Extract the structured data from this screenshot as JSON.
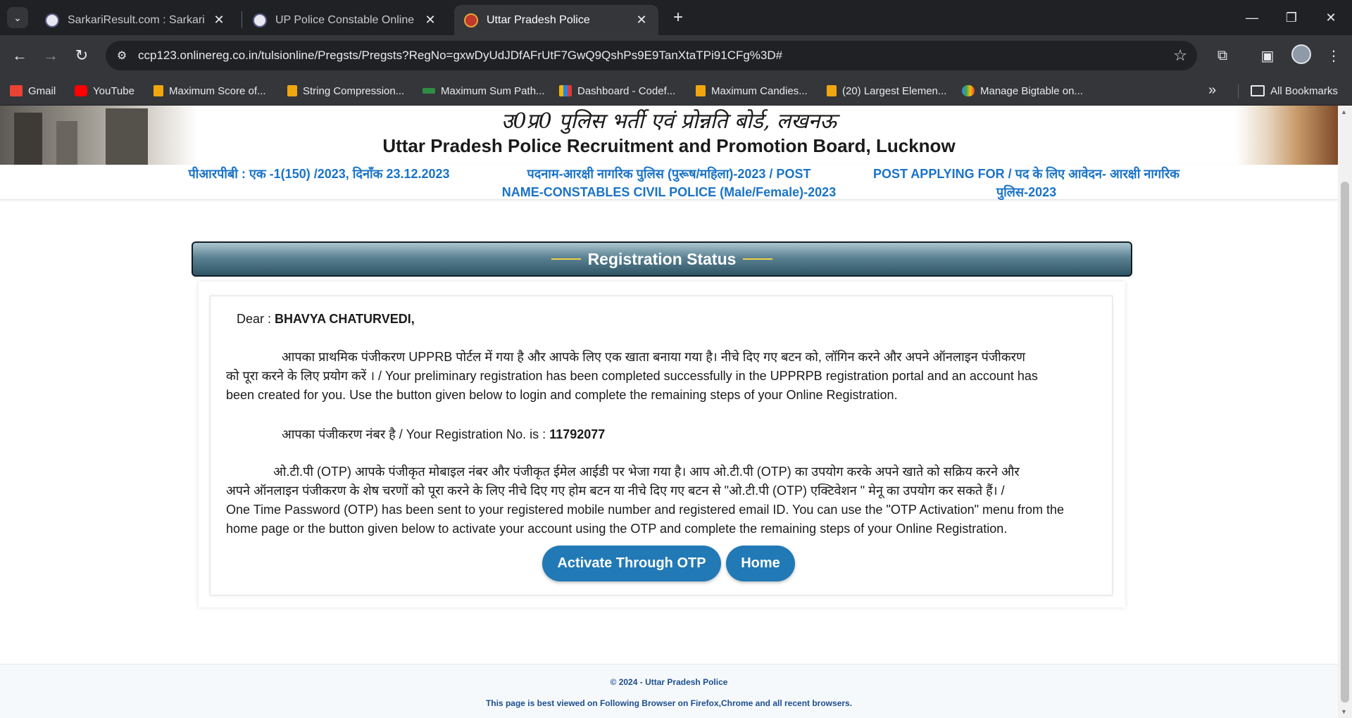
{
  "browser": {
    "tabs": [
      {
        "title": "SarkariResult.com : Sarkari Resu",
        "active": false
      },
      {
        "title": "UP Police Constable Online For",
        "active": false
      },
      {
        "title": "Uttar Pradesh Police",
        "active": true
      }
    ],
    "new_tab_symbol": "+",
    "url": "ccp123.onlinereg.co.in/tulsionline/Pregsts/Pregsts?RegNo=gxwDyUdJDfAFrUtF7GwQ9QshPs9E9TanXtaTPi91CFg%3D#",
    "bookmarks": [
      {
        "label": "Gmail",
        "icon": "gmail-icon",
        "color": "#ea4335"
      },
      {
        "label": "YouTube",
        "icon": "youtube-icon",
        "color": "#ff0000"
      },
      {
        "label": "Maximum Score of...",
        "icon": "leetcode-icon",
        "color": "#f0a70f"
      },
      {
        "label": "String Compression...",
        "icon": "leetcode-icon",
        "color": "#f0a70f"
      },
      {
        "label": "Maximum Sum Path...",
        "icon": "gfg-icon",
        "color": "#2f8d46"
      },
      {
        "label": "Dashboard - Codef...",
        "icon": "codeforces-icon",
        "color": "#f4b400"
      },
      {
        "label": "Maximum Candies...",
        "icon": "leetcode-icon",
        "color": "#f0a70f"
      },
      {
        "label": "(20) Largest Elemen...",
        "icon": "leetcode-icon",
        "color": "#f0a70f"
      },
      {
        "label": "Manage Bigtable on...",
        "icon": "google-cloud-icon",
        "color": "#4285f4"
      }
    ],
    "all_bookmarks": "All Bookmarks"
  },
  "banner": {
    "hindi_title": "उ0प्र0 पुलिस भर्ती एवं प्रोन्नति बोर्ड, लखनऊ",
    "english_title": "Uttar Pradesh Police Recruitment and Promotion Board, Lucknow"
  },
  "info": {
    "col1": "पीआरपीबी : एक -1(150) /2023, दिनाँक 23.12.2023",
    "col2_line1": "पदनाम-आरक्षी नागरिक पुलिस (पुरूष/महिला)-2023 / POST",
    "col2_line2": "NAME-CONSTABLES CIVIL POLICE (Male/Female)-2023",
    "col3_line1": "POST APPLYING FOR / पद के लिए आवेदन- आरक्षी नागरिक",
    "col3_line2": "पुलिस-2023"
  },
  "status": {
    "heading": "Registration Status",
    "dear_prefix": "Dear :",
    "name": "BHAVYA CHATURVEDI,",
    "para1_line1": "आपका प्राथमिक पंजीकरण UPPRB पोर्टल में गया है और आपके लिए एक खाता बनाया गया है। नीचे दिए गए बटन को, लॉगिन करने और अपने ऑनलाइन पंजीकरण",
    "para1_line2": "को पूरा करने के लिए प्रयोग करें । / Your preliminary registration has been completed successfully in the UPPRPB registration portal and an account has",
    "para1_line3": "been created for you. Use the button given below to login and complete the remaining steps of your Online Registration.",
    "regno_label": "आपका पंजीकरण नंबर है / Your Registration No. is :",
    "regno_value": "11792077",
    "para2_line1": "ओ.टी.पी (OTP) आपके पंजीकृत मोबाइल नंबर और पंजीकृत ईमेल आईडी पर भेजा गया है। आप ओ.टी.पी (OTP) का उपयोग करके अपने खाते को सक्रिय करने और",
    "para2_line2": "अपने ऑनलाइन पंजीकरण के शेष चरणों को पूरा करने के लिए नीचे दिए गए होम बटन या नीचे दिए गए बटन से \"ओ.टी.पी (OTP) एक्टिवेशन \" मेनू का उपयोग कर सकते हैं। /",
    "para2_line3": "One Time Password (OTP) has been sent to your registered mobile number and registered email ID. You can use the \"OTP Activation\" menu from the",
    "para2_line4": "home page or the button given below to activate your account using the OTP and complete the remaining steps of your Online Registration.",
    "activate_button": "Activate Through OTP",
    "home_button": "Home"
  },
  "footer": {
    "copyright": "© 2024 - Uttar Pradesh Police",
    "browser_note": "This page is best viewed on Following Browser on Firefox,Chrome and all recent browsers."
  }
}
